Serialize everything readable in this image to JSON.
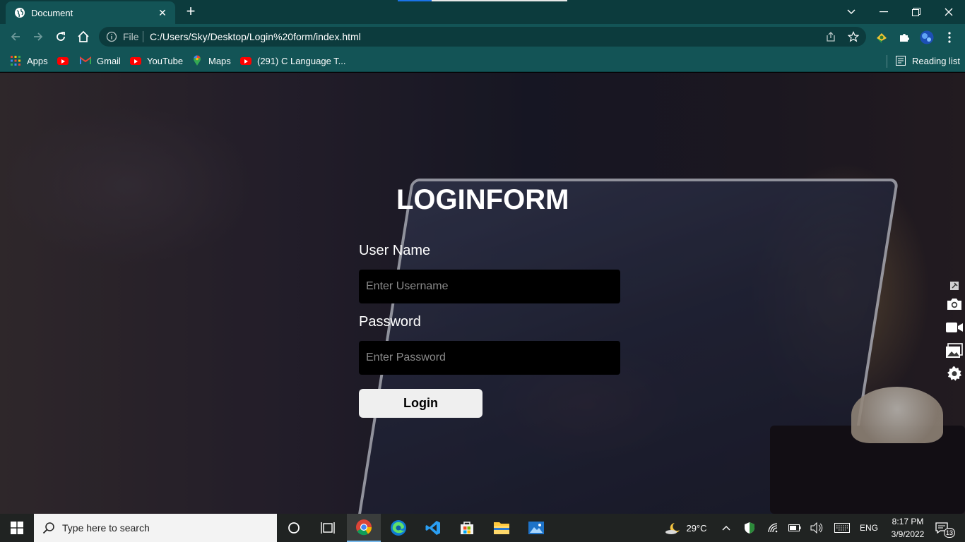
{
  "browser": {
    "tab_title": "Document",
    "tab_close": "✕",
    "new_tab": "+",
    "scheme_label": "File",
    "url": "C:/Users/Sky/Desktop/Login%20form/index.html",
    "window_controls": {
      "minimize": "—",
      "restore": "❐",
      "close": "✕",
      "tab_search": "⌄"
    },
    "bookmarks": [
      {
        "label": "Apps",
        "icon": "apps-grid-icon"
      },
      {
        "label": "",
        "icon": "youtube-icon"
      },
      {
        "label": "Gmail",
        "icon": "gmail-icon"
      },
      {
        "label": "YouTube",
        "icon": "youtube-icon"
      },
      {
        "label": "Maps",
        "icon": "maps-icon"
      },
      {
        "label": "(291) C Language T...",
        "icon": "youtube-icon"
      }
    ],
    "reading_list": "Reading list"
  },
  "page": {
    "title": "LOGINFORM",
    "username_label": "User Name",
    "username_placeholder": "Enter Username",
    "password_label": "Password",
    "password_placeholder": "Enter Password",
    "login_button": "Login"
  },
  "taskbar": {
    "search_placeholder": "Type here to search",
    "weather": "29°C",
    "language": "ENG",
    "time": "8:17 PM",
    "date": "3/9/2022",
    "notifications": "13"
  },
  "colors": {
    "chrome_dark": "#0c3b3d",
    "chrome_light": "#135456",
    "input_bg": "#000000",
    "button_bg": "#efefef"
  }
}
